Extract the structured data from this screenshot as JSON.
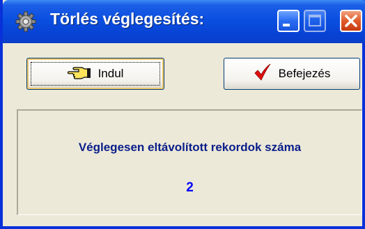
{
  "window": {
    "title": "Törlés véglegesítés:"
  },
  "toolbar": {
    "start_label": "Indul",
    "start_icon": "pointing-hand-icon",
    "finish_label": "Befejezés",
    "finish_icon": "red-checkmark-icon"
  },
  "result": {
    "label": "Véglegesen eltávolított rekordok száma",
    "value": "2"
  },
  "colors": {
    "titlebar": "#0a4fe0",
    "label_text": "#0a1e8a",
    "value_text": "#0000ff",
    "close_button": "#e05a2a"
  }
}
